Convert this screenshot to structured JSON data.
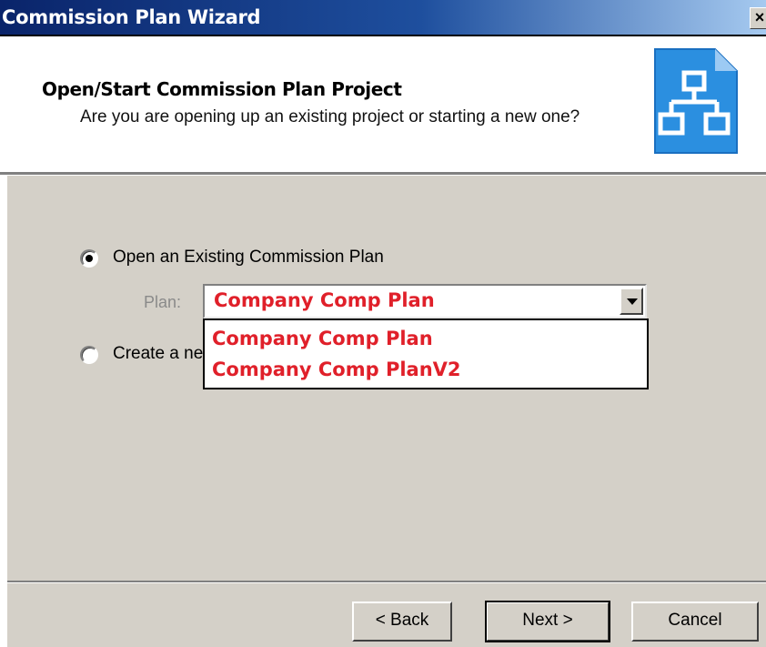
{
  "window": {
    "title": "Commission Plan Wizard",
    "close_glyph": "×"
  },
  "header": {
    "title": "Open/Start Commission Plan Project",
    "subtitle": "Are you are opening up an existing project or starting a new one?",
    "icon": "org-chart-icon"
  },
  "options": {
    "open_existing": {
      "label": "Open an Existing Commission Plan",
      "selected": true
    },
    "create_new": {
      "label": "Create a ne",
      "selected": false
    }
  },
  "plan": {
    "label": "Plan:",
    "selected_value": "Company Comp Plan",
    "dropdown_options": [
      "Company Comp Plan",
      "Company Comp PlanV2"
    ]
  },
  "buttons": {
    "back": "< Back",
    "next": "Next >",
    "cancel": "Cancel"
  },
  "colors": {
    "accent_text": "#e0202a",
    "panel": "#d4d0c8",
    "titlebar": "#0a246a"
  }
}
